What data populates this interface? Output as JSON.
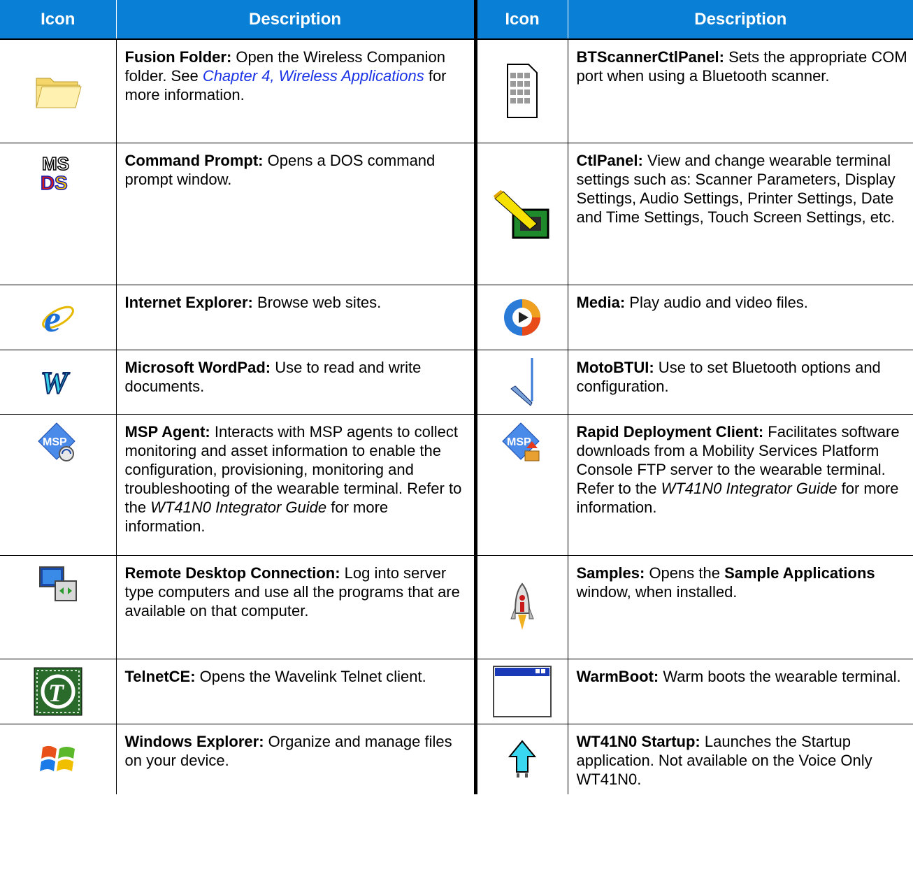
{
  "headers": {
    "icon": "Icon",
    "description": "Description"
  },
  "left": [
    {
      "icon": "folder-icon",
      "title": "Fusion",
      "rest_bold": " Folder",
      "text": ": Open the Wireless Companion folder. See ",
      "link": "Chapter 4, Wireless Applications",
      "after": " for more information."
    },
    {
      "icon": "ms-dos-icon",
      "title": "Command Prompt:",
      "text": " Opens a DOS command prompt window."
    },
    {
      "icon": "internet-explorer-icon",
      "title": "Internet Explorer:",
      "text": " Browse web sites."
    },
    {
      "icon": "wordpad-icon",
      "title": "Microsoft WordPad:",
      "text": " Use to read and write documents."
    },
    {
      "icon": "msp-agent-icon",
      "title": "MSP Agent:",
      "text": " Interacts with MSP agents to collect monitoring and asset information to enable the configuration, provisioning, monitoring and troubleshooting of the wearable terminal. Refer to the ",
      "italic": "WT41N0 Integrator Guide",
      "after": " for more information."
    },
    {
      "icon": "remote-desktop-icon",
      "title": "Remote Desktop Connection:",
      "text": " Log into server type computers and use all the programs that are available on that computer."
    },
    {
      "icon": "telnet-icon",
      "title": "TelnetCE:",
      "text": " Opens the Wavelink Telnet client."
    },
    {
      "icon": "windows-explorer-icon",
      "title": "Windows Explorer:",
      "text": " Organize and manage files on your device."
    }
  ],
  "right": [
    {
      "icon": "bt-scanner-panel-icon",
      "title": "BTScannerCtlPanel:",
      "text": " Sets the appropriate COM port when using a Bluetooth scanner."
    },
    {
      "icon": "control-panel-icon",
      "title": "CtlPanel:",
      "text": " View and change wearable terminal settings such as: Scanner Parameters, Display Settings, Audio Settings, Printer Settings, Date and Time Settings, Touch Screen Settings, etc."
    },
    {
      "icon": "media-player-icon",
      "title": "Media:",
      "text": " Play audio and video files."
    },
    {
      "icon": "bluetooth-checkmark-icon",
      "title": "MotoBTUI:",
      "text": " Use to set Bluetooth options and configuration."
    },
    {
      "icon": "rapid-deployment-icon",
      "title": "Rapid Deployment Client:",
      "text": " Facilitates software downloads from a Mobility Services Platform Console FTP server to the wearable terminal. Refer to the ",
      "italic": "WT41N0 Integrator Guide",
      "after": " for more information."
    },
    {
      "icon": "samples-rocket-icon",
      "title": "Samples:",
      "text": " Opens the ",
      "bold2": "Sample Applications",
      "after": " window, when installed."
    },
    {
      "icon": "warmboot-window-icon",
      "title": "WarmBoot:",
      "text": " Warm boots the wearable terminal."
    },
    {
      "icon": "startup-arrow-icon",
      "title": "WT41N0 Startup:",
      "text": " Launches the Startup application. Not available on the Voice Only WT41N0."
    }
  ],
  "colors": {
    "header_bg": "#0a7fd6",
    "link": "#1a33e6"
  }
}
